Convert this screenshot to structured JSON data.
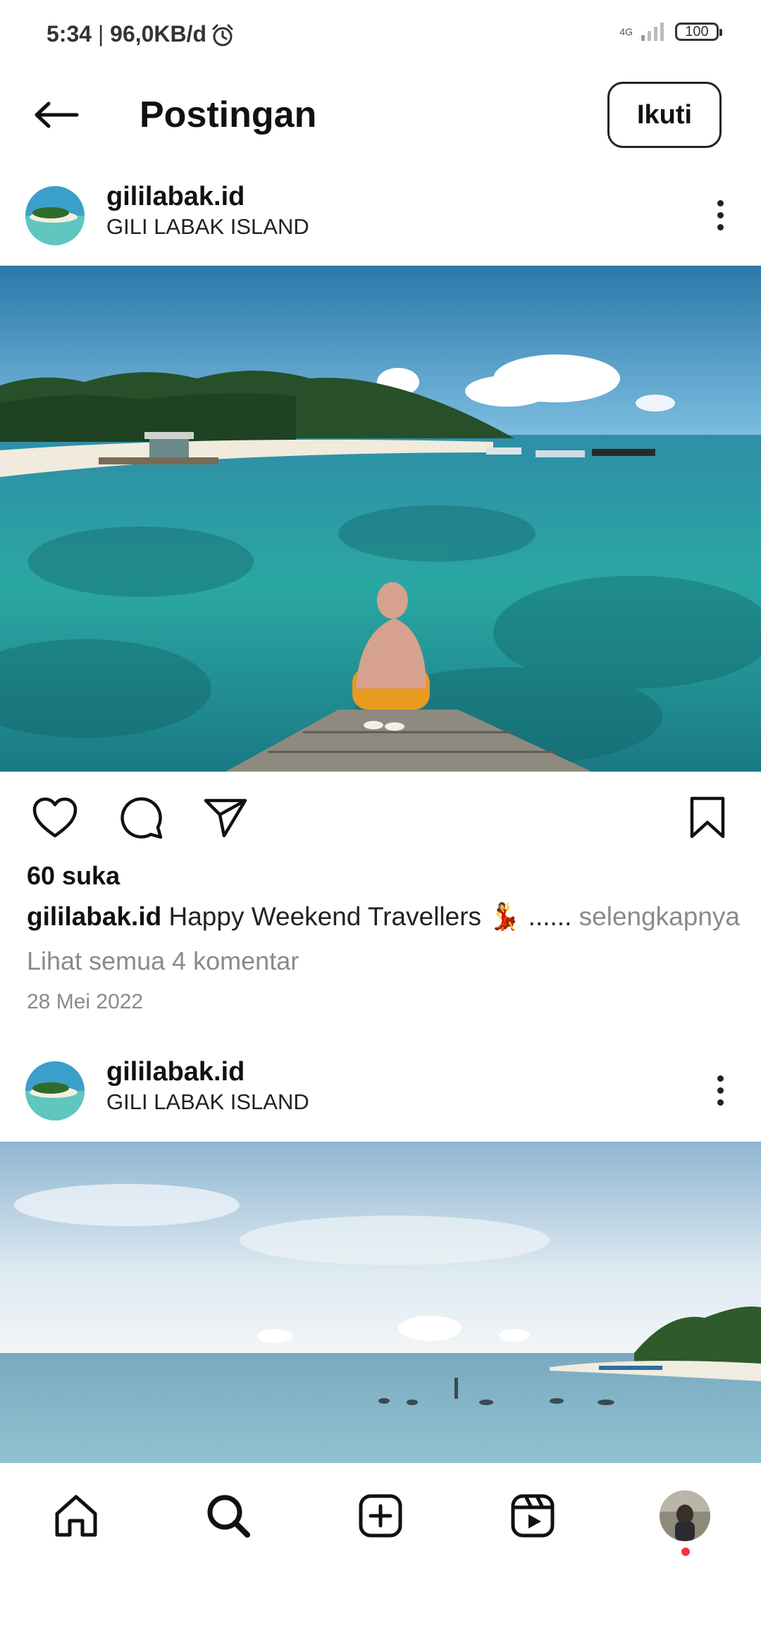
{
  "status": {
    "time": "5:34",
    "speed": "96,0KB/d",
    "network": "4G",
    "battery": "100"
  },
  "header": {
    "title": "Postingan",
    "follow_label": "Ikuti"
  },
  "post": {
    "username": "gililabak.id",
    "location": "GILI LABAK ISLAND",
    "likes": "60 suka",
    "caption_user": "gililabak.id",
    "caption_text": "Happy Weekend Travellers 💃",
    "caption_ellipsis": "......",
    "caption_more": "selengkapnya",
    "comments_link": "Lihat semua 4 komentar",
    "date": "28 Mei 2022"
  },
  "next_post": {
    "username": "gililabak.id",
    "location": "GILI LABAK ISLAND"
  },
  "icons": {
    "back": "arrow-left-icon",
    "more": "more-vertical-icon",
    "like": "heart-icon",
    "comment": "comment-icon",
    "share": "send-icon",
    "save": "bookmark-icon",
    "home": "home-icon",
    "search": "search-icon",
    "create": "plus-square-icon",
    "reels": "reels-icon"
  },
  "colors": {
    "notification_dot": "#ff3040",
    "muted_text": "#8a8a8a"
  }
}
